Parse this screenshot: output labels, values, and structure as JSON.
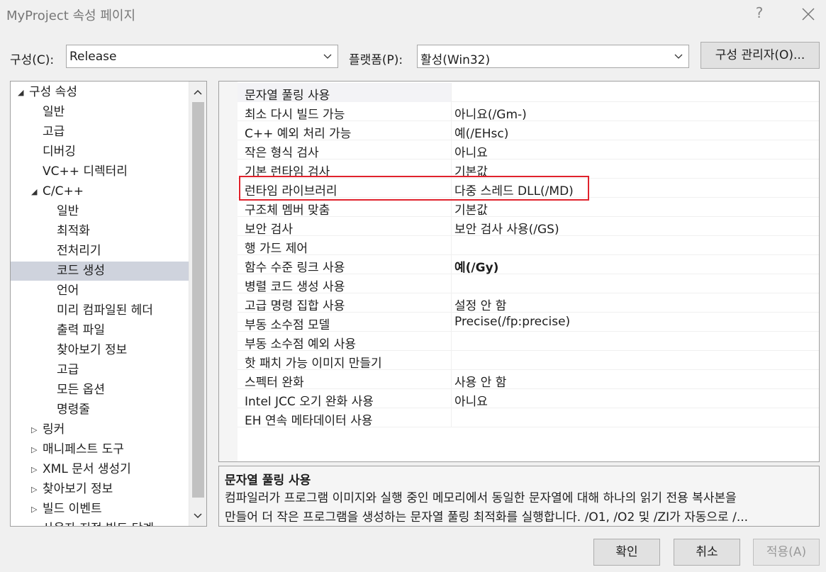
{
  "window": {
    "title": "MyProject 속성 페이지",
    "help_glyph": "?"
  },
  "config_row": {
    "config_label": "구성(C):",
    "config_value": "Release",
    "platform_label": "플랫폼(P):",
    "platform_value": "활성(Win32)",
    "manager_button": "구성 관리자(O)..."
  },
  "tree": {
    "items": [
      {
        "label": "구성 속성",
        "toggle": "◢",
        "selected": false
      },
      {
        "label": "일반",
        "toggle": "",
        "selected": false
      },
      {
        "label": "고급",
        "toggle": "",
        "selected": false
      },
      {
        "label": "디버깅",
        "toggle": "",
        "selected": false
      },
      {
        "label": "VC++ 디렉터리",
        "toggle": "",
        "selected": false
      },
      {
        "label": "C/C++",
        "toggle": "◢",
        "selected": false
      },
      {
        "label": "일반",
        "toggle": "",
        "selected": false
      },
      {
        "label": "최적화",
        "toggle": "",
        "selected": false
      },
      {
        "label": "전처리기",
        "toggle": "",
        "selected": false
      },
      {
        "label": "코드 생성",
        "toggle": "",
        "selected": true
      },
      {
        "label": "언어",
        "toggle": "",
        "selected": false
      },
      {
        "label": "미리 컴파일된 헤더",
        "toggle": "",
        "selected": false
      },
      {
        "label": "출력 파일",
        "toggle": "",
        "selected": false
      },
      {
        "label": "찾아보기 정보",
        "toggle": "",
        "selected": false
      },
      {
        "label": "고급",
        "toggle": "",
        "selected": false
      },
      {
        "label": "모든 옵션",
        "toggle": "",
        "selected": false
      },
      {
        "label": "명령줄",
        "toggle": "",
        "selected": false
      },
      {
        "label": "링커",
        "toggle": "▷",
        "selected": false
      },
      {
        "label": "매니페스트 도구",
        "toggle": "▷",
        "selected": false
      },
      {
        "label": "XML 문서 생성기",
        "toggle": "▷",
        "selected": false
      },
      {
        "label": "찾아보기 정보",
        "toggle": "▷",
        "selected": false
      },
      {
        "label": "빌드 이벤트",
        "toggle": "▷",
        "selected": false
      },
      {
        "label": "사용자 지정 빌드 단계",
        "toggle": "▷",
        "selected": false
      }
    ]
  },
  "properties": [
    {
      "name": "문자열 풀링 사용",
      "value": "",
      "bold": false
    },
    {
      "name": "최소 다시 빌드 가능",
      "value": "아니요(/Gm-)",
      "bold": false
    },
    {
      "name": "C++ 예외 처리 가능",
      "value": "예(/EHsc)",
      "bold": false
    },
    {
      "name": "작은 형식 검사",
      "value": "아니요",
      "bold": false
    },
    {
      "name": "기본 런타임 검사",
      "value": "기본값",
      "bold": false
    },
    {
      "name": "런타임 라이브러리",
      "value": "다중 스레드 DLL(/MD)",
      "bold": false
    },
    {
      "name": "구조체 멤버 맞춤",
      "value": "기본값",
      "bold": false
    },
    {
      "name": "보안 검사",
      "value": "보안 검사 사용(/GS)",
      "bold": false
    },
    {
      "name": "행 가드 제어",
      "value": "",
      "bold": false
    },
    {
      "name": "함수 수준 링크 사용",
      "value": "예(/Gy)",
      "bold": true
    },
    {
      "name": "병렬 코드 생성 사용",
      "value": "",
      "bold": false
    },
    {
      "name": "고급 명령 집합 사용",
      "value": "설정 안 함",
      "bold": false
    },
    {
      "name": "부동 소수점 모델",
      "value": "Precise(/fp:precise)",
      "bold": false
    },
    {
      "name": "부동 소수점 예외 사용",
      "value": "",
      "bold": false
    },
    {
      "name": "핫 패치 가능 이미지 만들기",
      "value": "",
      "bold": false
    },
    {
      "name": "스펙터 완화",
      "value": "사용 안 함",
      "bold": false
    },
    {
      "name": "Intel JCC 오기 완화 사용",
      "value": "아니요",
      "bold": false
    },
    {
      "name": "EH 연속 메타데이터 사용",
      "value": "",
      "bold": false
    }
  ],
  "description": {
    "title": "문자열 풀링 사용",
    "line1": "컴파일러가 프로그램 이미지와 실행 중인 메모리에서 동일한 문자열에 대해 하나의 읽기 전용 복사본을",
    "line2": "만들어 더 작은 프로그램을 생성하는 문자열 풀링 최적화를 실행합니다. /O1, /O2 및 /ZI가 자동으로 /..."
  },
  "buttons": {
    "ok": "확인",
    "cancel": "취소",
    "apply": "적용(A)"
  },
  "colors": {
    "highlight_border": "#e0222c",
    "selection": "#cfd3dd"
  }
}
